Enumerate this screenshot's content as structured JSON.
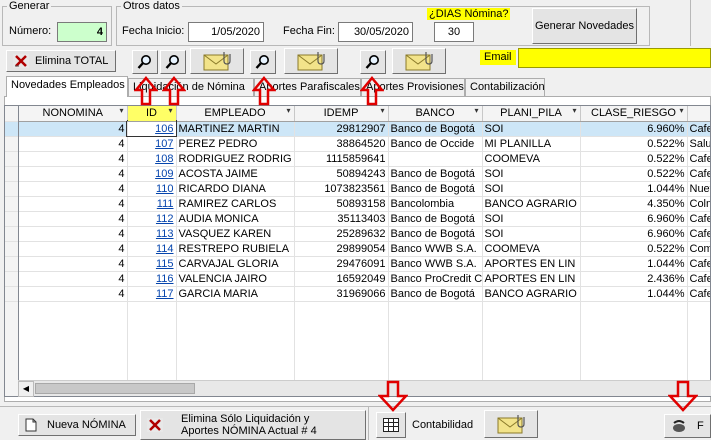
{
  "generar": {
    "legend": "Generar",
    "numero_label": "Número:",
    "numero_value": "4"
  },
  "otros": {
    "legend": "Otros datos",
    "fecha_inicio_label": "Fecha Inicio:",
    "fecha_inicio_value": "1/05/2020",
    "fecha_fin_label": "Fecha Fin:",
    "fecha_fin_value": "30/05/2020",
    "dias_label": "¿DIAS Nómina?",
    "dias_value": "30",
    "generar_btn": "Generar Novedades"
  },
  "toolbar": {
    "elimina_total": "Elimina TOTAL",
    "email_label": "Email"
  },
  "tabs": [
    {
      "label": "Novedades Empleados"
    },
    {
      "label": "Liquidación de Nómina"
    },
    {
      "label": "Aportes Parafiscales"
    },
    {
      "label": "Aportes Provisiones"
    },
    {
      "label": "Contabilización"
    }
  ],
  "grid": {
    "columns": [
      "NONOMINA",
      "ID",
      "EMPLEADO",
      "IDEMP",
      "BANCO",
      "PLANI_PILA",
      "CLASE_RIESGO",
      ""
    ],
    "rows": [
      {
        "nonomina": "4",
        "id": "106",
        "empleado": "MARTINEZ MARTIN",
        "idemp": "29812907",
        "banco": "Banco de Bogotá",
        "plani": "SOI",
        "clase": "6.960%",
        "extra": "Cafes"
      },
      {
        "nonomina": "4",
        "id": "107",
        "empleado": "PEREZ PEDRO",
        "idemp": "38864520",
        "banco": "Banco  de  Occide",
        "plani": "MI PLANILLA",
        "clase": "0.522%",
        "extra": "Salud"
      },
      {
        "nonomina": "4",
        "id": "108",
        "empleado": "RODRIGUEZ RODRIG",
        "idemp": "1115859641",
        "banco": "",
        "plani": "COOMEVA",
        "clase": "0.522%",
        "extra": "Cafes"
      },
      {
        "nonomina": "4",
        "id": "109",
        "empleado": "ACOSTA JAIME",
        "idemp": "50894243",
        "banco": "Banco de Bogotá",
        "plani": "SOI",
        "clase": "0.522%",
        "extra": "Cafes"
      },
      {
        "nonomina": "4",
        "id": "110",
        "empleado": "RICARDO DIANA",
        "idemp": "1073823561",
        "banco": "Banco de Bogotá",
        "plani": "SOI",
        "clase": "1.044%",
        "extra": "Nuev"
      },
      {
        "nonomina": "4",
        "id": "111",
        "empleado": "RAMIREZ CARLOS",
        "idemp": "50893158",
        "banco": "Bancolombia",
        "plani": "BANCO AGRARIO",
        "clase": "4.350%",
        "extra": "Colm"
      },
      {
        "nonomina": "4",
        "id": "112",
        "empleado": "AUDIA MONICA",
        "idemp": "35113403",
        "banco": "Banco de Bogotá",
        "plani": "SOI",
        "clase": "6.960%",
        "extra": "Cafes"
      },
      {
        "nonomina": "4",
        "id": "113",
        "empleado": "VASQUEZ KAREN",
        "idemp": "25289632",
        "banco": "Banco de Bogotá",
        "plani": "SOI",
        "clase": "6.960%",
        "extra": "Cafes"
      },
      {
        "nonomina": "4",
        "id": "114",
        "empleado": "RESTREPO RUBIELA",
        "idemp": "29899054",
        "banco": "Banco WWB S.A.",
        "plani": "COOMEVA",
        "clase": "0.522%",
        "extra": "Comf"
      },
      {
        "nonomina": "4",
        "id": "115",
        "empleado": "CARVAJAL GLORIA",
        "idemp": "29476091",
        "banco": "Banco WWB S.A.",
        "plani": "APORTES EN LIN",
        "clase": "1.044%",
        "extra": "Cafes"
      },
      {
        "nonomina": "4",
        "id": "116",
        "empleado": "VALENCIA JAIRO",
        "idemp": "16592049",
        "banco": "Banco ProCredit Co",
        "plani": "APORTES EN LIN",
        "clase": "2.436%",
        "extra": "Cafes"
      },
      {
        "nonomina": "4",
        "id": "117",
        "empleado": "GARCIA MARIA",
        "idemp": "31969066",
        "banco": "Banco de Bogotá",
        "plani": "BANCO AGRARIO",
        "clase": "1.044%",
        "extra": "Cafes"
      }
    ]
  },
  "bottom": {
    "nueva_nomina": "Nueva NÓMINA",
    "elimina_solo_1": "Elimina Sólo Liquidación y",
    "elimina_solo_2": "Aportes NÓMINA Actual # 4",
    "contabilidad": "Contabilidad",
    "fin_letter": "F"
  },
  "colors": {
    "accent_yellow": "#ffff00",
    "numero_green": "#ccffcc",
    "red_arrow": "#e00000",
    "selection": "#cde6f7"
  }
}
